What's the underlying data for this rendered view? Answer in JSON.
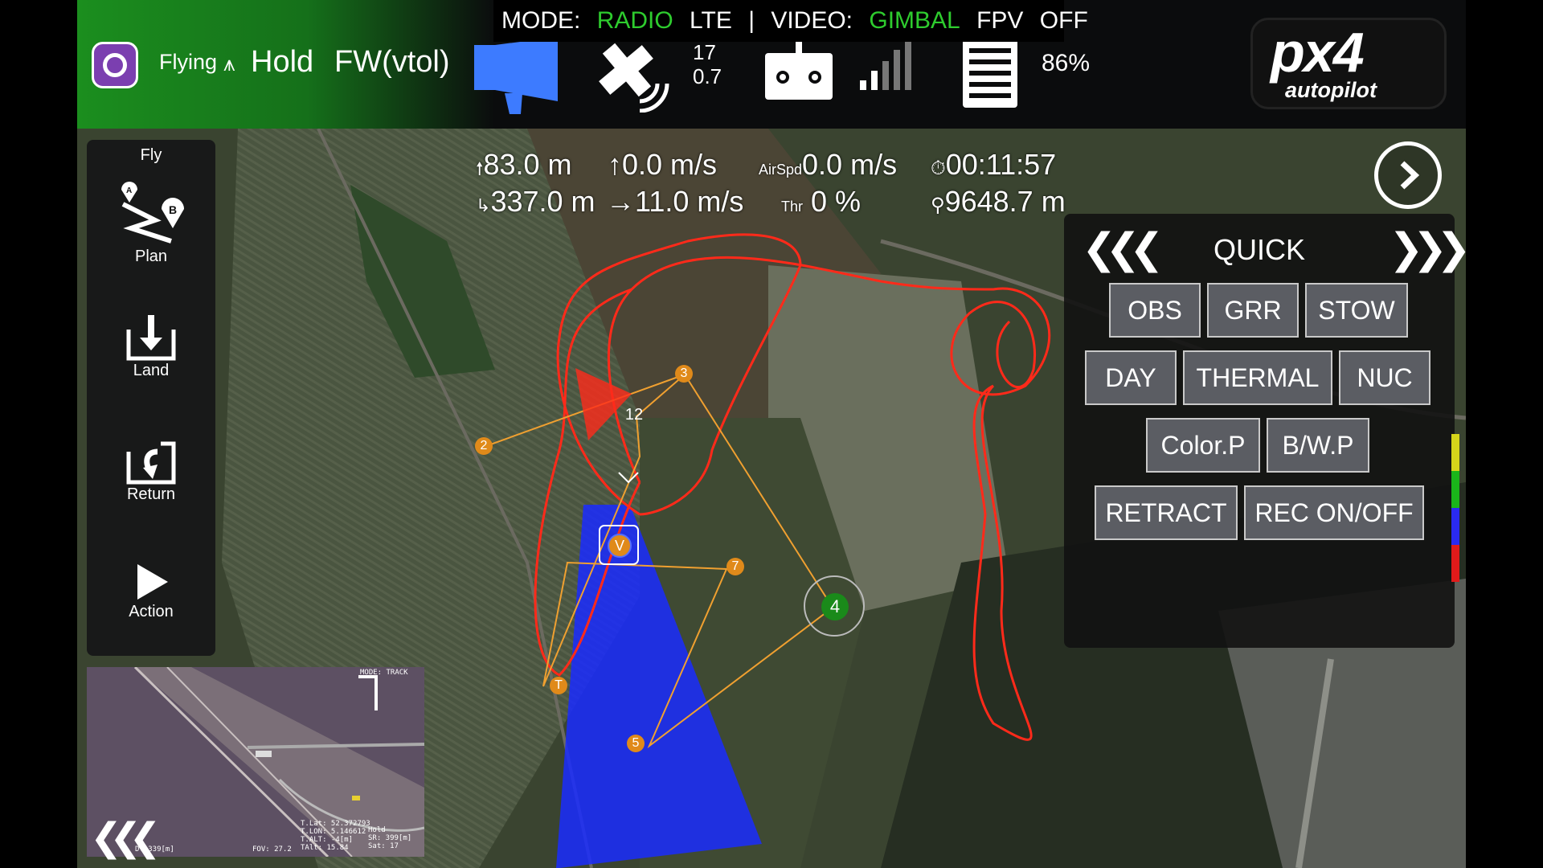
{
  "mode_bar": {
    "mode_label": "MODE:",
    "mode_value": "RADIO",
    "link": "LTE",
    "sep": "|",
    "video_label": "VIDEO:",
    "video_value": "GIMBAL",
    "fpv": "FPV",
    "off": "OFF"
  },
  "toolbar": {
    "flight_state": "Flying",
    "flight_mode": "Hold",
    "vehicle_type": "FW(vtol)",
    "gps_count": "17",
    "gps_hdop": "0.7",
    "battery": "86%",
    "logo_big": "px4",
    "logo_small": "autopilot",
    "accent": "#1b8e1e",
    "status_ok": "#2ecc2e"
  },
  "toolstrip": {
    "header": "Fly",
    "items": [
      {
        "label": "Plan",
        "icon": "plan-icon"
      },
      {
        "label": "Land",
        "icon": "land-icon"
      },
      {
        "label": "Return",
        "icon": "return-icon"
      },
      {
        "label": "Action",
        "icon": "play-icon"
      }
    ]
  },
  "telemetry": {
    "altitude": "83.0 m",
    "climb_rate": "0.0 m/s",
    "airspeed_label": "AirSpd",
    "airspeed": "0.0 m/s",
    "flight_time": "00:11:57",
    "distance_home": "337.0 m",
    "ground_speed": "11.0 m/s",
    "throttle_label": "Thr",
    "throttle": "0 %",
    "total_distance": "9648.7 m"
  },
  "quick_panel": {
    "title": "QUICK",
    "buttons": [
      "OBS",
      "GRR",
      "STOW",
      "DAY",
      "THERMAL",
      "NUC",
      "Color.P",
      "B/W.P",
      "RETRACT",
      "REC ON/OFF"
    ]
  },
  "map": {
    "waypoints": [
      "2",
      "3",
      "12",
      "7",
      "4",
      "5",
      "T"
    ],
    "vehicle_marker": "V",
    "flight_path_color": "#ff2a1a",
    "mission_color": "#f0a030",
    "footprint_color": "#1a2cff",
    "current_wp_color": "#1a8a1a"
  },
  "video": {
    "hud_topright": "MODE: TRACK",
    "hud_bottom_left": "D: 339[m]",
    "hud_fov": "FOV: 27.2",
    "hud_coords": "T.Lat: 52.372793\nT.LON: 5.146612\nT.ALT: -4[m]\nTAlt: 15.84",
    "hud_right": "Hold\nSR: 399[m]\nSat: 17"
  }
}
